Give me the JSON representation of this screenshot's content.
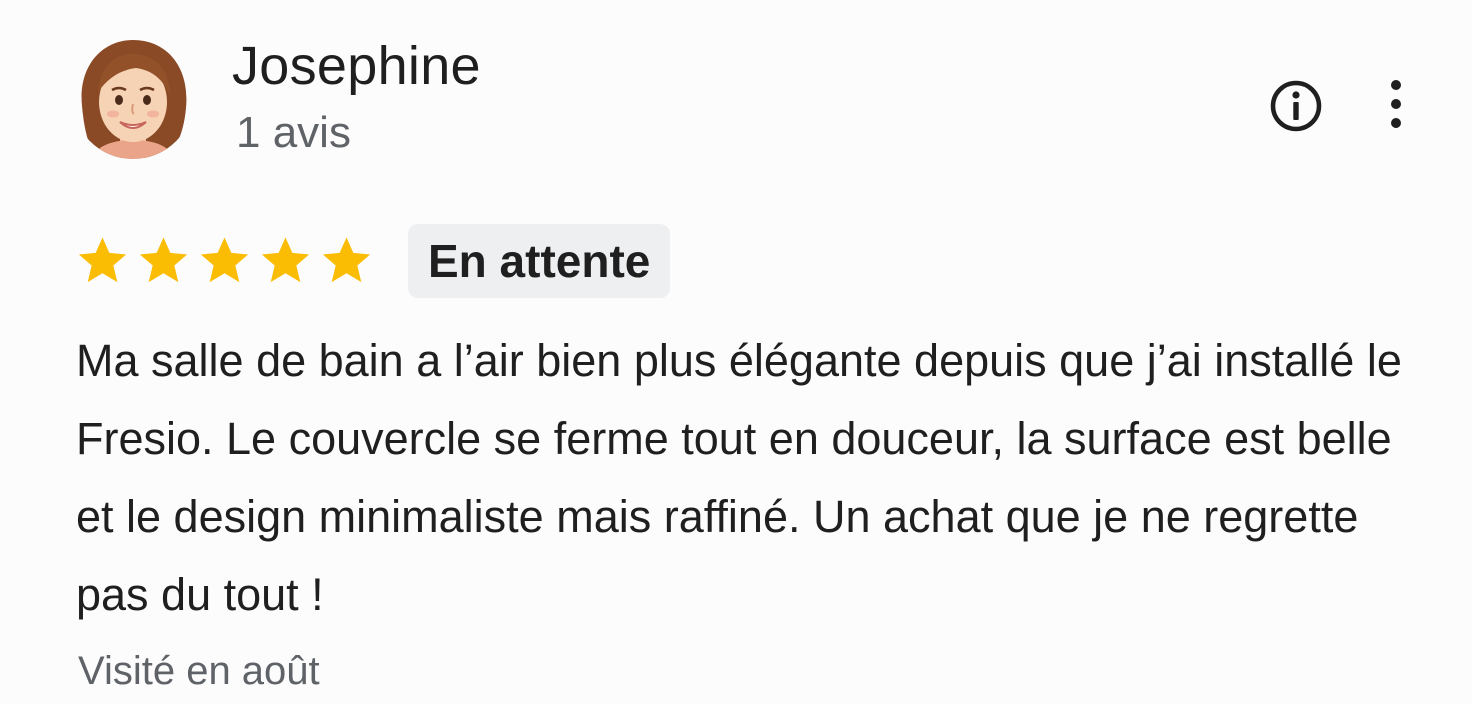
{
  "reviewer": {
    "name": "Josephine",
    "review_count": "1 avis"
  },
  "review": {
    "rating": 5,
    "rating_max": 5,
    "status_badge": "En attente",
    "text": "Ma salle de bain a l’air bien plus élégante depuis que j’ai installé le Fresio. Le couvercle se ferme tout en douceur, la surface est belle et le design minimaliste mais raffiné. Un achat que je ne regrette pas du tout !",
    "visit": "Visité en août"
  },
  "icons": {
    "info": "info-circle-icon",
    "more": "more-vert-icon",
    "star": "star-filled-icon"
  },
  "colors": {
    "star": "#fbbc04",
    "badge_bg": "#eeeff0",
    "text_primary": "#1f1f1f",
    "text_secondary": "#5f6368"
  }
}
